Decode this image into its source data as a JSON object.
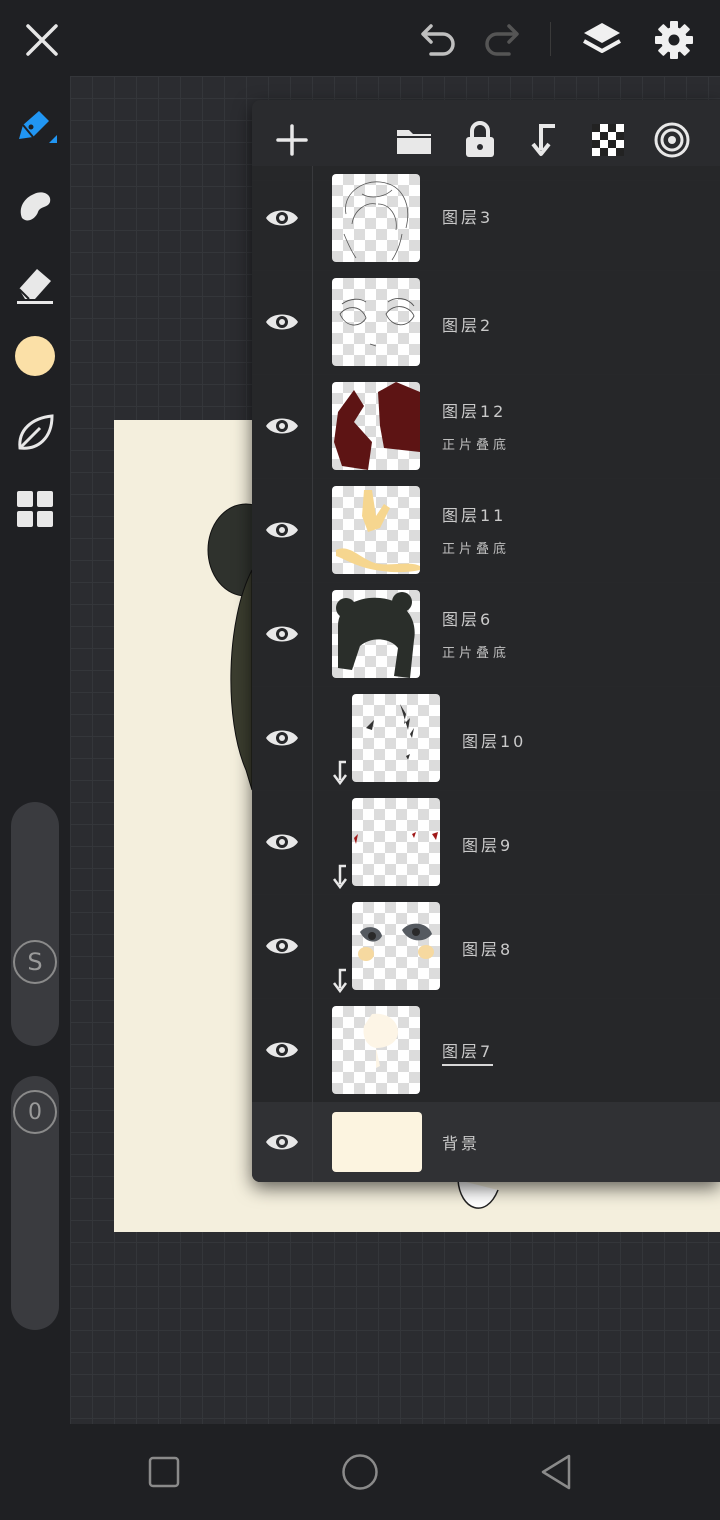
{
  "topbar": {
    "close_icon": "close-icon",
    "undo_icon": "undo-icon",
    "redo_icon": "redo-icon",
    "layers_icon": "layers-icon",
    "settings_icon": "gear-icon"
  },
  "sidebar": {
    "tools": [
      "pen-tool",
      "smudge-tool",
      "eraser-tool",
      "color-swatch",
      "leaf-tool",
      "gallery-grid"
    ],
    "current_color": "#fbe0a7",
    "size_slider_label": "S",
    "opacity_slider_label": "0"
  },
  "layers_panel": {
    "toolbar": [
      "add-layer",
      "folder",
      "lock",
      "clip",
      "transparency",
      "blend"
    ],
    "layers": [
      {
        "name": "图层3",
        "mode": "",
        "clipped": false
      },
      {
        "name": "图层2",
        "mode": "",
        "clipped": false
      },
      {
        "name": "图层12",
        "mode": "正片叠底",
        "clipped": false
      },
      {
        "name": "图层11",
        "mode": "正片叠底",
        "clipped": false
      },
      {
        "name": "图层6",
        "mode": "正片叠底",
        "clipped": false
      },
      {
        "name": "图层10",
        "mode": "",
        "clipped": true
      },
      {
        "name": "图层9",
        "mode": "",
        "clipped": true
      },
      {
        "name": "图层8",
        "mode": "",
        "clipped": true
      },
      {
        "name": "图层7",
        "mode": "",
        "clipped": false,
        "selected": true
      },
      {
        "name": "背景",
        "mode": "",
        "clipped": false,
        "background": true
      }
    ]
  },
  "colors": {
    "background": "#1f2023",
    "canvas_grid": "#2b2c30",
    "paper": "#f4efdd",
    "accent": "#2196f3",
    "bg_layer": "#fcf4e0"
  }
}
